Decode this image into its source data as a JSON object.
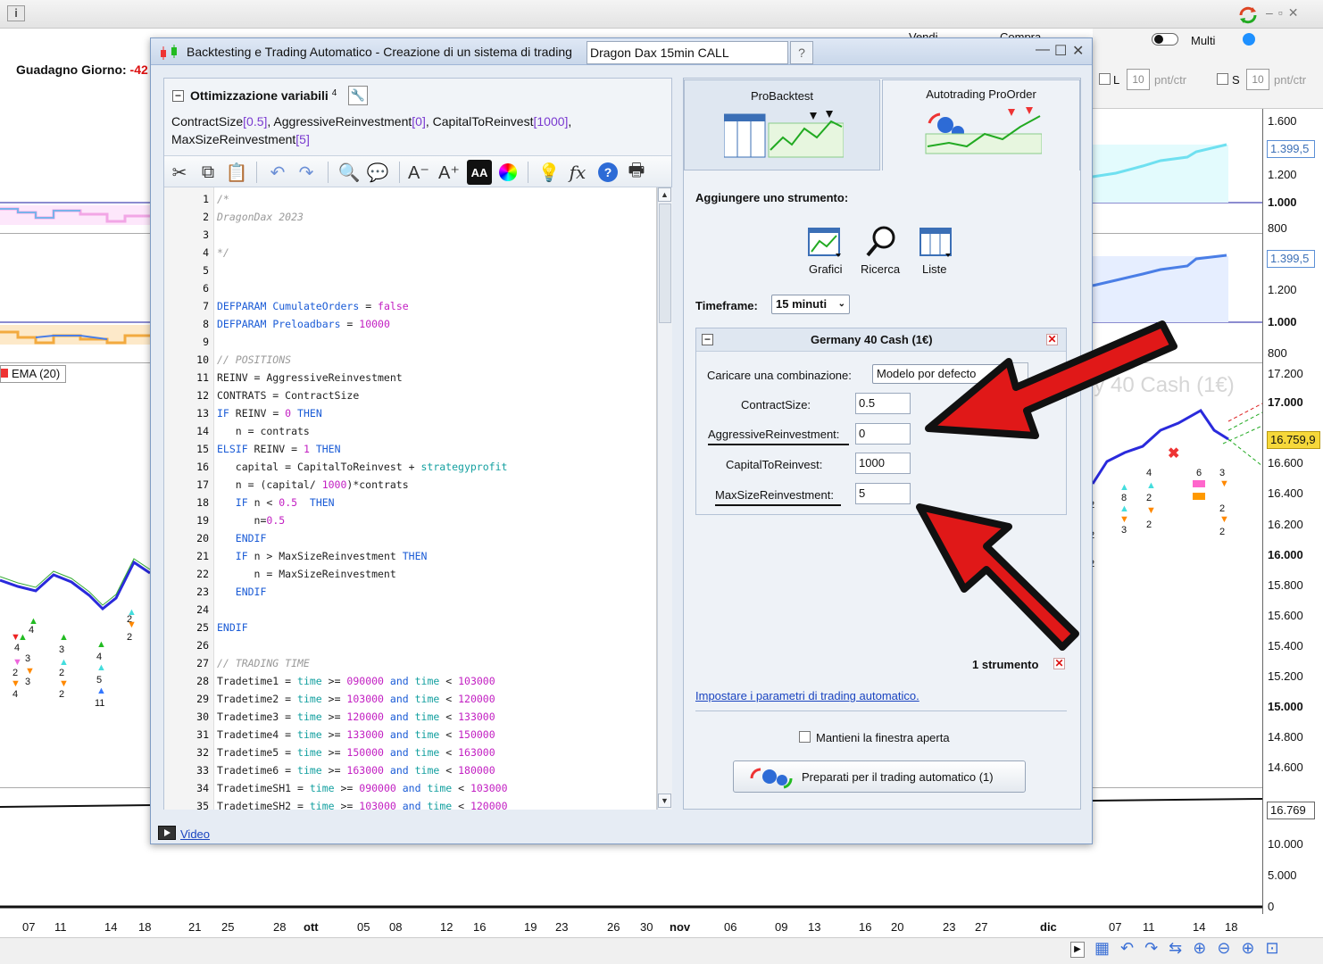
{
  "platform": {
    "guadagno_label": "Guadagno Giorno:",
    "guadagno_value": "-42",
    "ema_label": "EMA (20)",
    "vendi_label": "Vendi",
    "compra_label": "Compra",
    "multi_label": "Multi",
    "l_label": "L",
    "l_qty": "10",
    "l_unit": "pnt/ctr",
    "s_label": "S",
    "s_qty": "10",
    "s_unit": "pnt/ctr",
    "watermark": "ny 40 Cash (1€)",
    "price_badge_1": "1.399,5",
    "price_badge_2": "1.399,5",
    "price_badge_3": "16.759,9",
    "price_badge_4": "16.769",
    "axis_panel1": [
      "1.600",
      "1.400",
      "1.200",
      "1.000",
      "800"
    ],
    "axis_panel2": [
      "1.400",
      "1.200",
      "1.000",
      "800"
    ],
    "axis_panel3": [
      "17.200",
      "17.000",
      "16.800",
      "16.600",
      "16.400",
      "16.200",
      "16.000",
      "15.800",
      "15.600",
      "15.400",
      "15.200",
      "15.000",
      "14.800",
      "14.600"
    ],
    "axis_panel4": [
      "16.774",
      "10.000",
      "5.000",
      "0"
    ],
    "x_ticks": [
      "07",
      "11",
      "14",
      "18",
      "21",
      "25",
      "28",
      "ott",
      "05",
      "08",
      "12",
      "16",
      "19",
      "23",
      "26",
      "30",
      "nov",
      "06",
      "09",
      "13",
      "16",
      "20",
      "23",
      "27",
      "dic",
      "07",
      "11",
      "14",
      "18"
    ]
  },
  "dialog": {
    "title": "Backtesting e Trading Automatico - Creazione di un sistema di trading",
    "system_name": "Dragon Dax 15min CALL",
    "optvar_title": "Ottimizzazione variabili",
    "optvar_count": "4",
    "variables": [
      {
        "name": "ContractSize",
        "value": "[0.5]",
        "sep": ", "
      },
      {
        "name": "AggressiveReinvestment",
        "value": "[0]",
        "sep": ", "
      },
      {
        "name": "CapitalToReinvest",
        "value": "[1000]",
        "sep": ","
      },
      {
        "name": "MaxSizeReinvestment",
        "value": "[5]",
        "sep": ""
      }
    ],
    "video_link": "Video"
  },
  "code_lines": [
    {
      "n": "1",
      "t": "/*"
    },
    {
      "n": "2",
      "t": "DragonDax 2023"
    },
    {
      "n": "3",
      "t": ""
    },
    {
      "n": "4",
      "t": "*/"
    },
    {
      "n": "5",
      "t": ""
    },
    {
      "n": "6",
      "t": ""
    },
    {
      "n": "7",
      "t": "DEFPARAM CumulateOrders = false"
    },
    {
      "n": "8",
      "t": "DEFPARAM Preloadbars = 10000"
    },
    {
      "n": "9",
      "t": ""
    },
    {
      "n": "10",
      "t": "// POSITIONS"
    },
    {
      "n": "11",
      "t": "REINV = AggressiveReinvestment"
    },
    {
      "n": "12",
      "t": "CONTRATS = ContractSize"
    },
    {
      "n": "13",
      "t": "IF REINV = 0 THEN"
    },
    {
      "n": "14",
      "t": "   n = contrats"
    },
    {
      "n": "15",
      "t": "ELSIF REINV = 1 THEN"
    },
    {
      "n": "16",
      "t": "   capital = CapitalToReinvest + strategyprofit"
    },
    {
      "n": "17",
      "t": "   n = (capital/ 1000)*contrats"
    },
    {
      "n": "18",
      "t": "   IF n < 0.5  THEN"
    },
    {
      "n": "19",
      "t": "      n=0.5"
    },
    {
      "n": "20",
      "t": "   ENDIF"
    },
    {
      "n": "21",
      "t": "   IF n > MaxSizeReinvestment THEN"
    },
    {
      "n": "22",
      "t": "      n = MaxSizeReinvestment"
    },
    {
      "n": "23",
      "t": "   ENDIF"
    },
    {
      "n": "24",
      "t": ""
    },
    {
      "n": "25",
      "t": "ENDIF"
    },
    {
      "n": "26",
      "t": ""
    },
    {
      "n": "27",
      "t": "// TRADING TIME"
    },
    {
      "n": "28",
      "t": "Tradetime1 = time >= 090000 and time < 103000"
    },
    {
      "n": "29",
      "t": "Tradetime2 = time >= 103000 and time < 120000"
    },
    {
      "n": "30",
      "t": "Tradetime3 = time >= 120000 and time < 133000"
    },
    {
      "n": "31",
      "t": "Tradetime4 = time >= 133000 and time < 150000"
    },
    {
      "n": "32",
      "t": "Tradetime5 = time >= 150000 and time < 163000"
    },
    {
      "n": "33",
      "t": "Tradetime6 = time >= 163000 and time < 180000"
    },
    {
      "n": "34",
      "t": "TradetimeSH1 = time >= 090000 and time < 103000"
    },
    {
      "n": "35",
      "t": "TradetimeSH2 = time >= 103000 and time < 120000"
    }
  ],
  "right": {
    "tab_probacktest": "ProBacktest",
    "tab_autotrading": "Autotrading ProOrder",
    "add_instrument": "Aggiungere uno strumento:",
    "grafici": "Grafici",
    "ricerca": "Ricerca",
    "liste": "Liste",
    "timeframe_label": "Timeframe:",
    "timeframe_value": "15 minuti",
    "instrument_title": "Germany 40 Cash (1€)",
    "load_combo_label": "Caricare una combinazione:",
    "load_combo_value": "Modelo por defecto",
    "params": [
      {
        "label": "ContractSize:",
        "value": "0.5"
      },
      {
        "label": "AggressiveReinvestment:",
        "value": "0"
      },
      {
        "label": "CapitalToReinvest:",
        "value": "1000"
      },
      {
        "label": "MaxSizeReinvestment:",
        "value": "5"
      }
    ],
    "instrument_count": "1 strumento",
    "settings_link": "Impostare i parametri di trading automatico.",
    "keep_open": "Mantieni la finestra aperta",
    "prepare_button": "Preparati per il trading automatico (1)"
  },
  "colors": {
    "arrow_red": "#e01818",
    "code_keyword": "#1a5bd6",
    "code_number": "#c21ec2",
    "code_comment": "#9a9a9a",
    "code_builtin": "#14a0a0",
    "link_blue": "#1a44c0"
  }
}
